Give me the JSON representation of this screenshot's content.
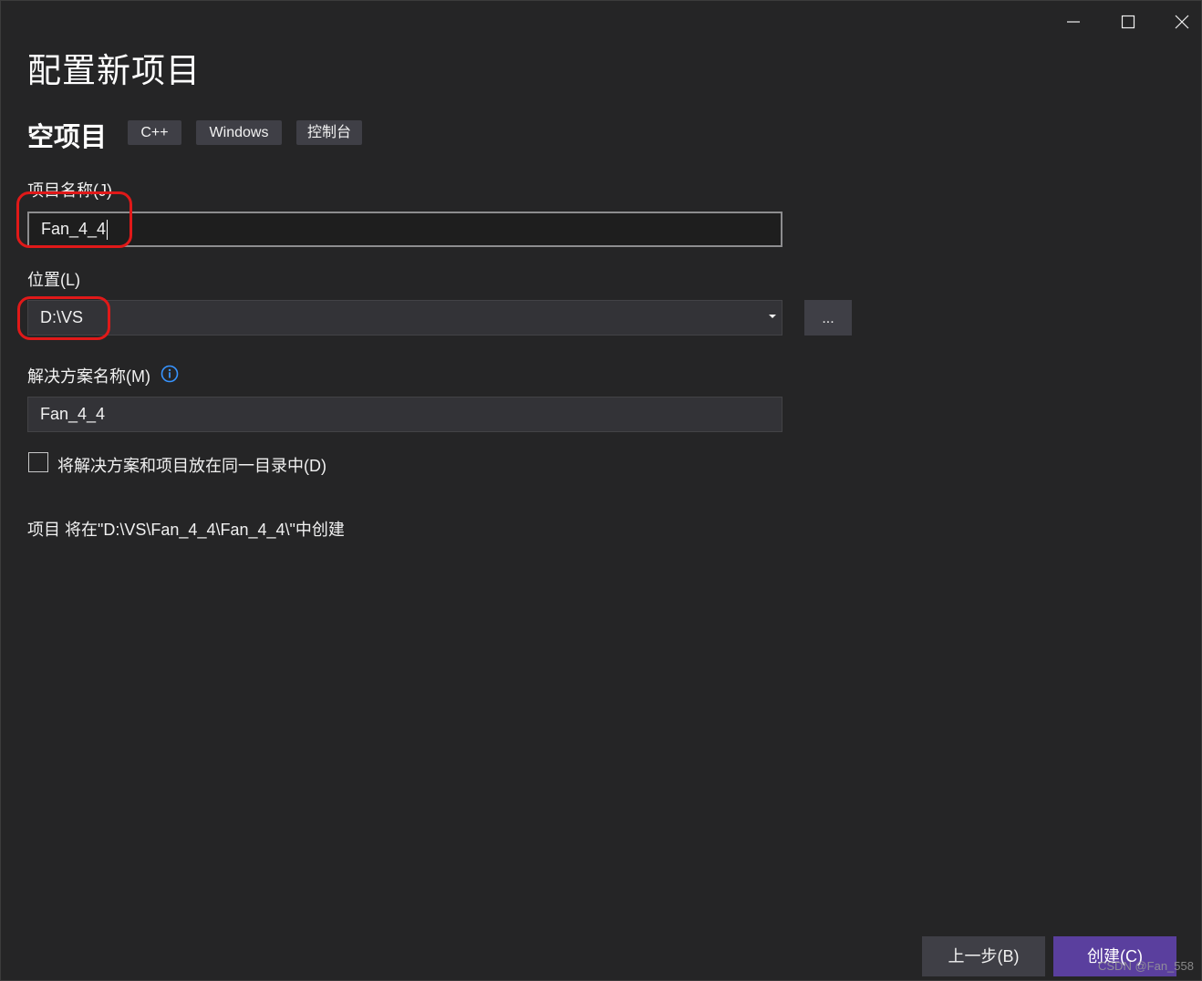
{
  "window": {
    "controls": {
      "minimize": "minimize-icon",
      "maximize": "maximize-icon",
      "close": "close-icon"
    }
  },
  "page": {
    "title": "配置新项目",
    "template_name": "空项目",
    "tags": [
      "C++",
      "Windows",
      "控制台"
    ]
  },
  "form": {
    "project_name_label": "项目名称(J)",
    "project_name_value": "Fan_4_4",
    "location_label": "位置(L)",
    "location_value": "D:\\VS",
    "browse_label": "...",
    "solution_name_label": "解决方案名称(M)",
    "solution_name_value": "Fan_4_4",
    "same_dir_label": "将解决方案和项目放在同一目录中(D)",
    "same_dir_checked": false,
    "status_text": "项目 将在\"D:\\VS\\Fan_4_4\\Fan_4_4\\\"中创建"
  },
  "footer": {
    "back_label": "上一步(B)",
    "create_label": "创建(C)"
  },
  "watermark": "CSDN @Fan_558",
  "colors": {
    "background": "#252526",
    "accent": "#5a3f9e",
    "annotation": "#e01919",
    "info": "#3794ff"
  }
}
